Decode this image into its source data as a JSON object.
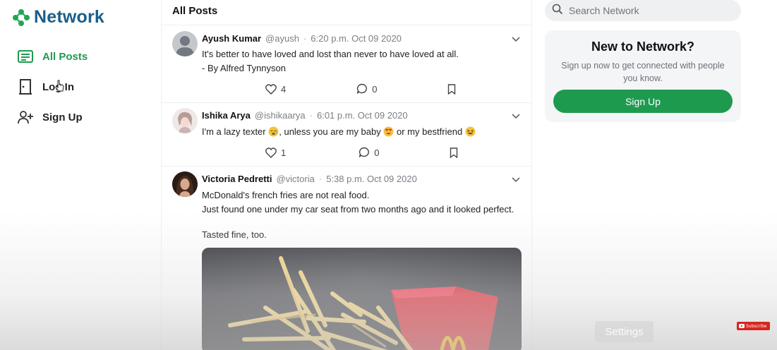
{
  "brand": {
    "name": "Network"
  },
  "nav": {
    "items": [
      {
        "label": "All Posts",
        "icon": "list-icon",
        "active": true
      },
      {
        "label": "Log In",
        "icon": "door-icon",
        "active": false
      },
      {
        "label": "Sign Up",
        "icon": "add-user-icon",
        "active": false
      }
    ]
  },
  "feed": {
    "title": "All Posts",
    "posts": [
      {
        "name": "Ayush Kumar",
        "handle": "@ayush",
        "sep": "·",
        "time": "6:20 p.m. Oct 09 2020",
        "lines": [
          "It's better to have loved and lost than never to have loved at all.",
          "- By Alfred Tynnyson"
        ],
        "likes": "4",
        "comments": "0"
      },
      {
        "name": "Ishika Arya",
        "handle": "@ishikaarya",
        "sep": "·",
        "time": "6:01 p.m. Oct 09 2020",
        "text_parts": [
          "I'm a lazy texter ",
          ", unless you are my baby ",
          " or my bestfriend "
        ],
        "likes": "1",
        "comments": "0"
      },
      {
        "name": "Victoria Pedretti",
        "handle": "@victoria",
        "sep": "·",
        "time": "5:38 p.m. Oct 09 2020",
        "lines": [
          "McDonald's french fries are not real food.",
          "Just found one under my car seat from two months ago and it looked perfect.",
          "",
          "Tasted fine, too."
        ]
      }
    ]
  },
  "search": {
    "placeholder": "Search Network"
  },
  "signup_card": {
    "title": "New to Network?",
    "subtitle": "Sign up now to get connected with people you know.",
    "button": "Sign Up"
  },
  "overlay": {
    "settings_label": "Settings",
    "youtube_label": "Subscribe"
  },
  "colors": {
    "accent_green": "#1e9a4f",
    "brand_blue": "#1a5f8a",
    "fries_red": "#d9202b"
  }
}
